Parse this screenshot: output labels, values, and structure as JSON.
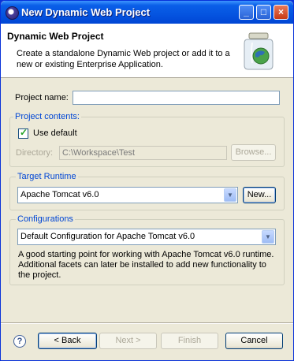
{
  "window": {
    "title": "New Dynamic Web Project",
    "minimize": "_",
    "maximize": "□",
    "close": "×"
  },
  "header": {
    "title": "Dynamic Web Project",
    "description": "Create a standalone Dynamic Web project or add it to a new or existing Enterprise Application."
  },
  "project_name": {
    "label": "Project name:",
    "value": ""
  },
  "project_contents": {
    "legend": "Project contents:",
    "use_default_label": "Use default",
    "use_default_checked": true,
    "directory_label": "Directory:",
    "directory_value": "C:\\Workspace\\Test",
    "browse_label": "Browse..."
  },
  "target_runtime": {
    "legend": "Target Runtime",
    "selected": "Apache Tomcat v6.0",
    "new_label": "New..."
  },
  "configurations": {
    "legend": "Configurations",
    "selected": "Default Configuration for Apache Tomcat v6.0",
    "description": "A good starting point for working with Apache Tomcat v6.0 runtime. Additional facets can later be installed to add new functionality to the project."
  },
  "footer": {
    "back": "< Back",
    "next": "Next >",
    "finish": "Finish",
    "cancel": "Cancel",
    "help": "?"
  }
}
